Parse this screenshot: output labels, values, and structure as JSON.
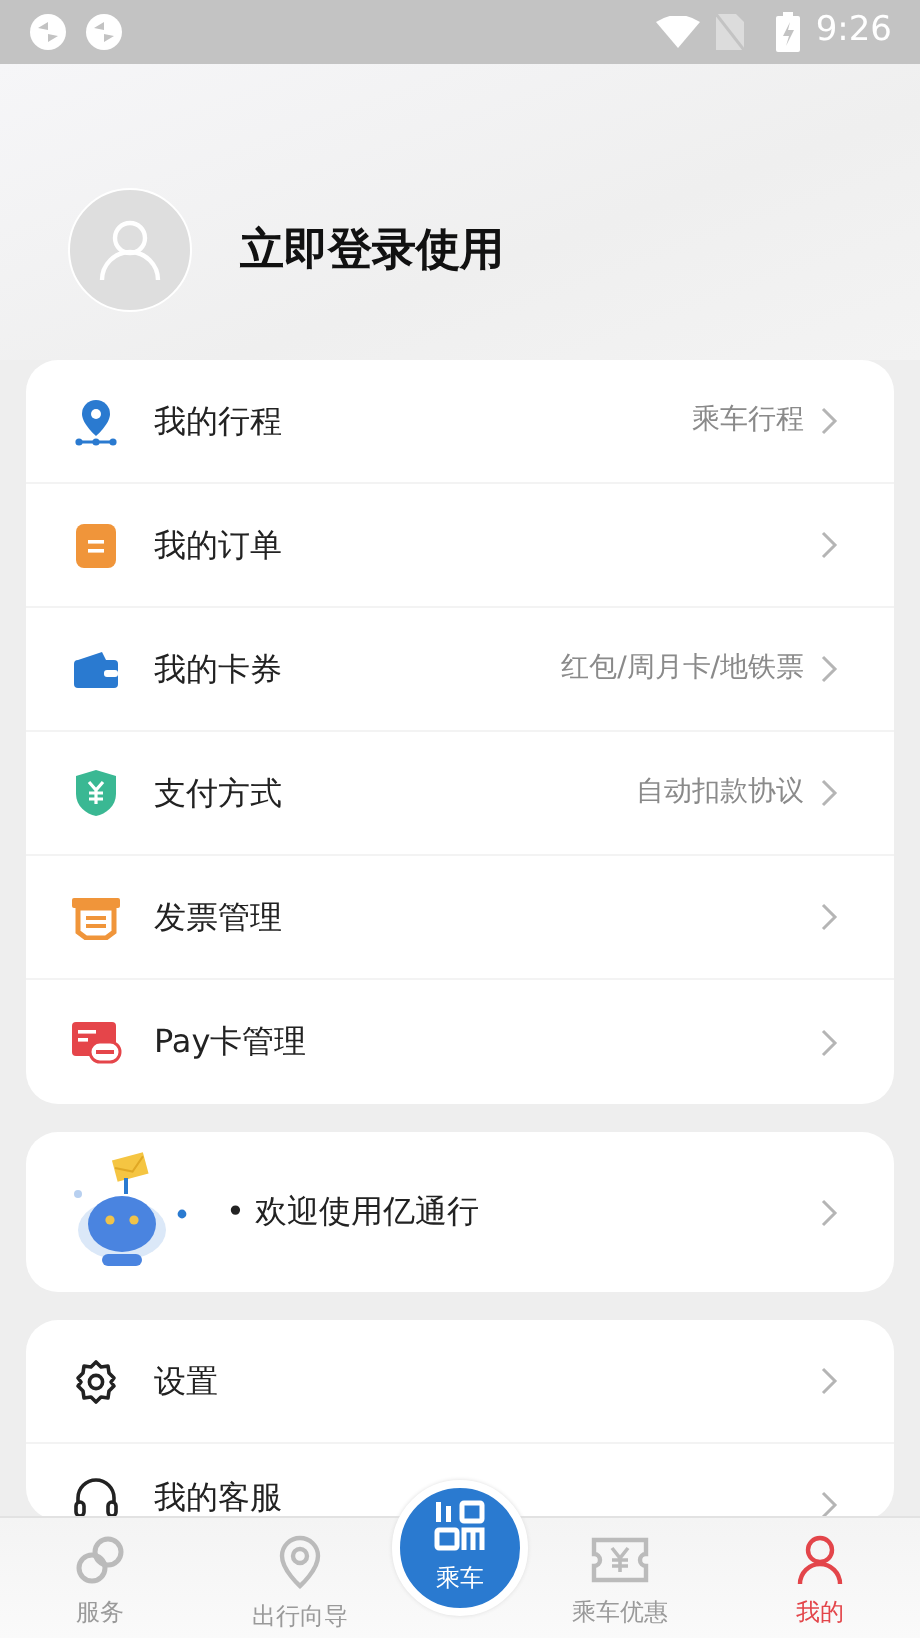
{
  "status_bar": {
    "time": "9:26"
  },
  "profile": {
    "login_text": "立即登录使用"
  },
  "menu": [
    {
      "kind": "route",
      "label": "我的行程",
      "hint": "乘车行程"
    },
    {
      "kind": "order",
      "label": "我的订单"
    },
    {
      "kind": "wallet",
      "label": "我的卡券",
      "hint": "红包/周月卡/地铁票"
    },
    {
      "kind": "shield",
      "label": "支付方式",
      "hint": "自动扣款协议"
    },
    {
      "kind": "invoice",
      "label": "发票管理"
    },
    {
      "kind": "paycard",
      "label": "Pay卡管理"
    }
  ],
  "message": {
    "text": "• 欢迎使用亿通行"
  },
  "settings": [
    {
      "kind": "gear",
      "label": "设置"
    },
    {
      "kind": "headset",
      "label": "我的客服"
    }
  ],
  "tab_bar": [
    {
      "kind": "service",
      "label": "服务",
      "selected": false
    },
    {
      "kind": "pin",
      "label": "出行向导",
      "selected": false
    },
    {
      "kind": "qr",
      "label": "乘车",
      "selected": false
    },
    {
      "kind": "ticket",
      "label": "乘车优惠",
      "selected": false
    },
    {
      "kind": "person",
      "label": "我的",
      "selected": true
    }
  ]
}
